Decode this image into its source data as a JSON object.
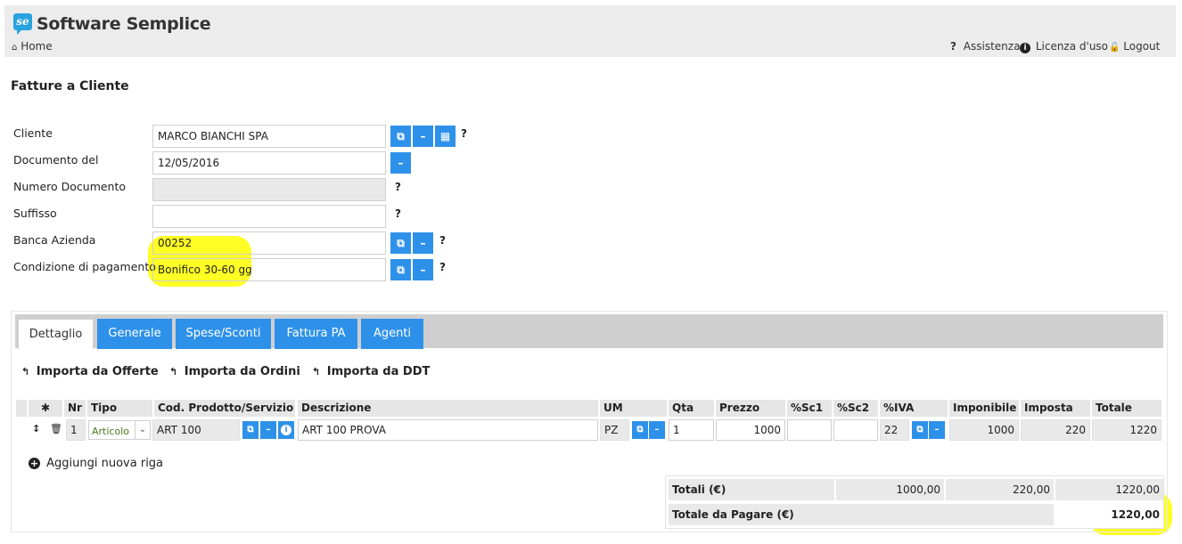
{
  "app": {
    "logo_text": "se",
    "title": "Software Semplice"
  },
  "nav": {
    "home": "Home",
    "links": [
      {
        "icon": "question-icon",
        "label": "Assistenza"
      },
      {
        "icon": "info-icon",
        "label": "Licenza d'uso"
      },
      {
        "icon": "logout-icon",
        "label": "Logout"
      }
    ]
  },
  "page": {
    "title": "Fatture a Cliente"
  },
  "form": {
    "cliente": {
      "label": "Cliente",
      "value": "MARCO BIANCHI SPA"
    },
    "documento": {
      "label": "Documento del",
      "value": "12/05/2016"
    },
    "numero": {
      "label": "Numero Documento",
      "value": ""
    },
    "suffisso": {
      "label": "Suffisso",
      "value": ""
    },
    "banca": {
      "label": "Banca Azienda",
      "value": "00252"
    },
    "pagamento": {
      "label": "Condizione di pagamento",
      "value": "Bonifico 30-60 gg"
    }
  },
  "tabs": [
    "Dettaglio",
    "Generale",
    "Spese/Sconti",
    "Fattura PA",
    "Agenti"
  ],
  "imports": [
    "Importa da Offerte",
    "Importa da Ordini",
    "Importa da DDT"
  ],
  "table": {
    "headers": {
      "nr": "Nr",
      "tipo": "Tipo",
      "cod": "Cod. Prodotto/Servizio",
      "descr": "Descrizione",
      "um": "UM",
      "qta": "Qta",
      "prezzo": "Prezzo",
      "sc1": "%Sc1",
      "sc2": "%Sc2",
      "iva": "%IVA",
      "imponibile": "Imponibile",
      "imposta": "Imposta",
      "totale": "Totale"
    },
    "row": {
      "nr": "1",
      "tipo": "Articolo",
      "cod": "ART 100",
      "descr": "ART 100 PROVA",
      "um": "PZ",
      "qta": "1",
      "prezzo": "1000",
      "sc1": "",
      "sc2": "",
      "iva": "22",
      "imponibile": "1000",
      "imposta": "220",
      "totale": "1220"
    }
  },
  "add_row": "Aggiungi nuova riga",
  "totals": {
    "label": "Totali (€)",
    "imponibile": "1000,00",
    "imposta": "220,00",
    "totale": "1220,00",
    "pay_label": "Totale da Pagare (€)",
    "pay_value": "1220,00"
  },
  "colors": {
    "accent": "#2e91e9",
    "highlight": "#ffff00"
  }
}
